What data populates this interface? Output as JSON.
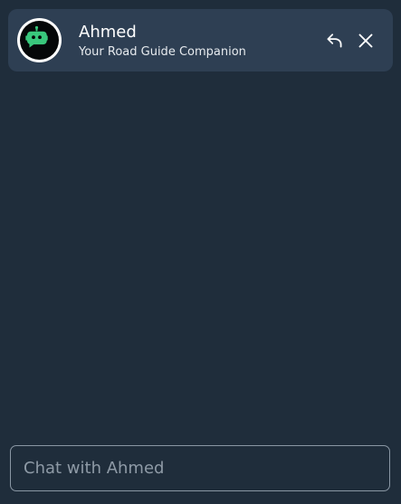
{
  "header": {
    "title": "Ahmed",
    "subtitle": "Your Road Guide Companion"
  },
  "input": {
    "placeholder": "Chat with Ahmed",
    "value": ""
  },
  "icons": {
    "avatar": "bot-icon",
    "back": "undo-icon",
    "close": "close-icon"
  },
  "colors": {
    "background": "#1f2d3b",
    "header": "#2e3f53",
    "accent": "#39c77c",
    "text": "#ffffff"
  }
}
